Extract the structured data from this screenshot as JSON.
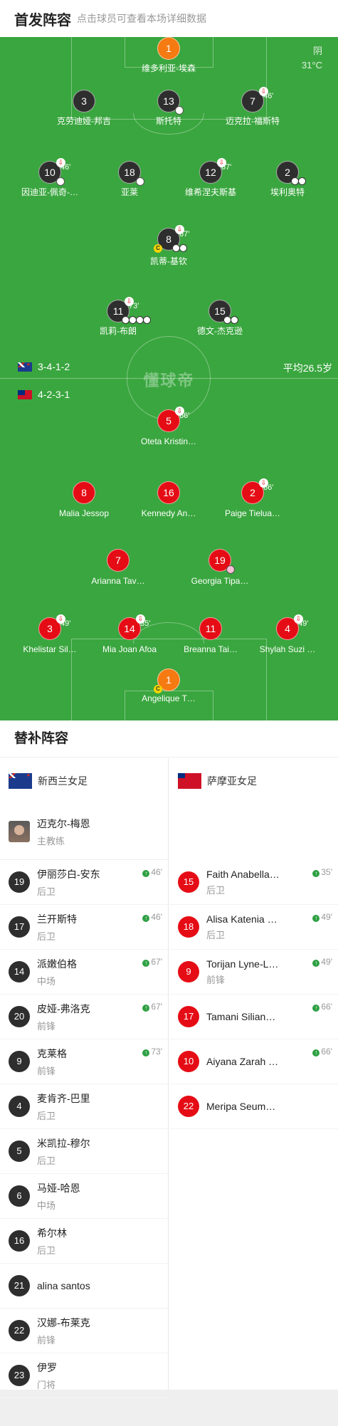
{
  "header": {
    "title": "首发阵容",
    "subtitle": "点击球员可查看本场详细数据"
  },
  "pitch": {
    "weather": "阴",
    "temperature": "31°C",
    "watermark": "懂球帝",
    "home_formation": "3-4-1-2",
    "away_formation": "4-2-3-1",
    "avg_age": "平均26.5岁",
    "home_players": [
      {
        "number": "1",
        "name": "维多利亚-埃森",
        "sub": ""
      },
      {
        "number": "3",
        "name": "克劳迪娅-邦吉",
        "sub": ""
      },
      {
        "number": "13",
        "name": "斯托特",
        "sub": ""
      },
      {
        "number": "7",
        "name": "迈克拉-福斯特",
        "sub": "46'"
      },
      {
        "number": "10",
        "name": "因迪亚-佩奇-…",
        "sub": "46'"
      },
      {
        "number": "18",
        "name": "亚莱",
        "sub": ""
      },
      {
        "number": "12",
        "name": "维希涅夫斯基",
        "sub": "67'"
      },
      {
        "number": "2",
        "name": "埃利奥特",
        "sub": ""
      },
      {
        "number": "8",
        "name": "凯蒂-基钦",
        "sub": "67'"
      },
      {
        "number": "11",
        "name": "凯莉-布朗",
        "sub": "73'"
      },
      {
        "number": "15",
        "name": "德文-杰克逊",
        "sub": ""
      }
    ],
    "away_players": [
      {
        "number": "5",
        "name": "Oteta Kristin…",
        "sub": "66'"
      },
      {
        "number": "8",
        "name": "Malia Jessop",
        "sub": ""
      },
      {
        "number": "16",
        "name": "Kennedy An…",
        "sub": ""
      },
      {
        "number": "2",
        "name": "Paige Tielua…",
        "sub": "66'"
      },
      {
        "number": "7",
        "name": "Arianna Tav…",
        "sub": ""
      },
      {
        "number": "19",
        "name": "Georgia Tipa…",
        "sub": ""
      },
      {
        "number": "3",
        "name": "Khelistar Sil…",
        "sub": "49'"
      },
      {
        "number": "14",
        "name": "Mia Joan Afoa",
        "sub": "35'"
      },
      {
        "number": "11",
        "name": "Breanna Tai…",
        "sub": ""
      },
      {
        "number": "4",
        "name": "Shylah Suzi …",
        "sub": "49'"
      },
      {
        "number": "1",
        "name": "Angelique T…",
        "sub": ""
      }
    ]
  },
  "subs": {
    "title": "替补阵容",
    "home": {
      "team": "新西兰女足",
      "coach": {
        "name": "迈克尔-梅恩",
        "role": "主教练"
      },
      "players": [
        {
          "number": "19",
          "name": "伊丽莎白-安东",
          "pos": "后卫",
          "time": "46'"
        },
        {
          "number": "17",
          "name": "兰开斯特",
          "pos": "后卫",
          "time": "46'"
        },
        {
          "number": "14",
          "name": "派嫩伯格",
          "pos": "中场",
          "time": "67'"
        },
        {
          "number": "20",
          "name": "皮娅-弗洛克",
          "pos": "前锋",
          "time": "67'"
        },
        {
          "number": "9",
          "name": "克莱格",
          "pos": "前锋",
          "time": "73'"
        },
        {
          "number": "4",
          "name": "麦肯齐-巴里",
          "pos": "后卫",
          "time": ""
        },
        {
          "number": "5",
          "name": "米凯拉-穆尔",
          "pos": "后卫",
          "time": ""
        },
        {
          "number": "6",
          "name": "马娅-哈恩",
          "pos": "中场",
          "time": ""
        },
        {
          "number": "16",
          "name": "希尔林",
          "pos": "后卫",
          "time": ""
        },
        {
          "number": "21",
          "name": "alina santos",
          "pos": "",
          "time": ""
        },
        {
          "number": "22",
          "name": "汉娜-布莱克",
          "pos": "前锋",
          "time": ""
        },
        {
          "number": "23",
          "name": "伊罗",
          "pos": "门将",
          "time": ""
        }
      ]
    },
    "away": {
      "team": "萨摩亚女足",
      "players": [
        {
          "number": "15",
          "name": "Faith Anabella…",
          "pos": "后卫",
          "time": "35'"
        },
        {
          "number": "18",
          "name": "Alisa Katenia …",
          "pos": "后卫",
          "time": "49'"
        },
        {
          "number": "9",
          "name": "Torijan Lyne-L…",
          "pos": "前锋",
          "time": "49'"
        },
        {
          "number": "17",
          "name": "Tamani Silian…",
          "pos": "",
          "time": "66'"
        },
        {
          "number": "10",
          "name": "Aiyana Zarah …",
          "pos": "",
          "time": "66'"
        },
        {
          "number": "22",
          "name": "Meripa Seum…",
          "pos": "",
          "time": ""
        }
      ]
    }
  }
}
